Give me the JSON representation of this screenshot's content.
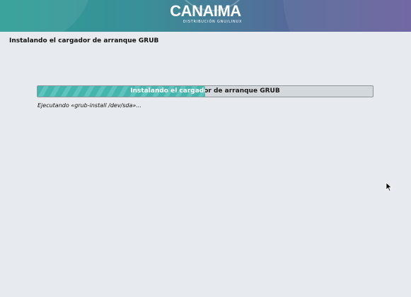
{
  "banner": {
    "brand_name": "CANAIMA",
    "brand_subtitle": "DISTRIBUCIÓN GNU/LINUX",
    "colors": [
      "#2d9d95",
      "#556a99",
      "#6a5f9e"
    ]
  },
  "page": {
    "title": "Instalando el cargador de arranque GRUB"
  },
  "progress": {
    "label": "Instalando el cargador de arranque GRUB",
    "percent": 50,
    "fill_color": "#45b5ae"
  },
  "status": {
    "text": "Ejecutando «grub-install /dev/sda»..."
  },
  "cursor": {
    "icon": "mouse-pointer-icon"
  }
}
